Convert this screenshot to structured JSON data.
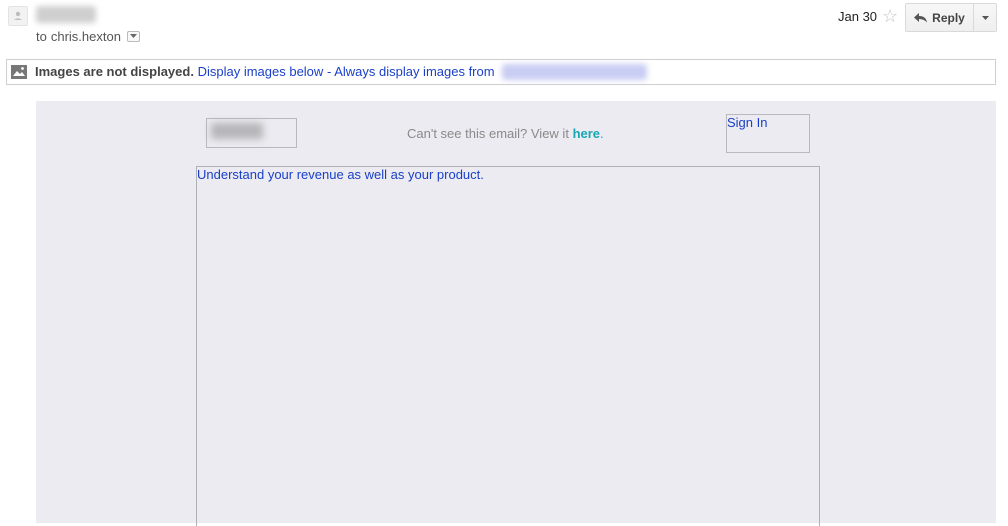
{
  "header": {
    "recipient_prefix": "to",
    "recipient": "chris.hexton",
    "date": "Jan 30",
    "reply_label": "Reply"
  },
  "images_bar": {
    "notice": "Images are not displayed.",
    "display_below": "Display images below",
    "separator": "-",
    "always_display": "Always display images from"
  },
  "email": {
    "view_online_text": "Can't see this email? View it",
    "view_online_link": "here",
    "view_online_suffix": ".",
    "sign_in": "Sign In",
    "image_alt": "Understand your revenue as well as your product."
  },
  "icons": {
    "avatar": "person-icon",
    "recipient_toggle": "chevron-down-icon",
    "star": "star-icon",
    "reply": "reply-arrow-icon",
    "more": "caret-down-icon",
    "image": "image-icon"
  },
  "colors": {
    "link": "#1a3fc8",
    "here_link": "#19a7b4",
    "email_background": "#ebebf1"
  }
}
